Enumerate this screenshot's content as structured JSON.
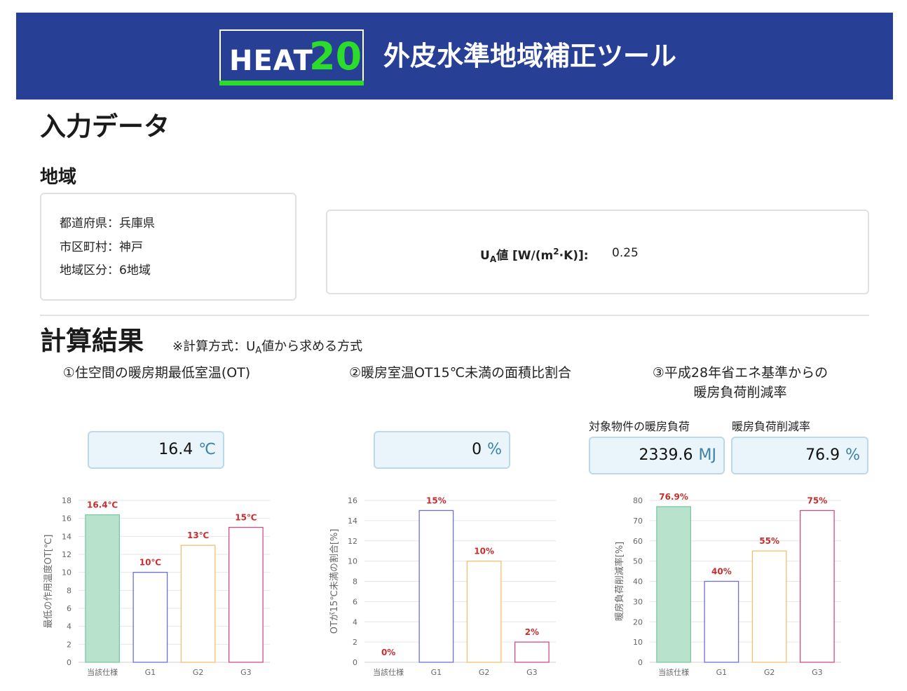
{
  "header": {
    "logo_text": "HEAT",
    "logo_number": "20",
    "title": "外皮水準地域補正ツール"
  },
  "input": {
    "heading": "入力データ",
    "region_heading": "地域",
    "prefecture": "都道府県：兵庫県",
    "city": "市区町村：神戸",
    "zone": "地域区分：6地域",
    "ua_label_prefix": "U",
    "ua_label_sub": "A",
    "ua_label_mid": "値 [W/(m",
    "ua_label_sup": "2",
    "ua_label_suffix": "·K)]:",
    "ua_value": "0.25"
  },
  "results": {
    "heading": "計算結果",
    "method_prefix": "※計算方式：U",
    "method_sub": "A",
    "method_suffix": "値から求める方式",
    "section1": {
      "title": "①住空間の暖房期最低室温(OT)",
      "value": "16.4",
      "unit": "℃"
    },
    "section2": {
      "title": "②暖房室温OT15℃未満の面積比割合",
      "value": "0",
      "unit": "%"
    },
    "section3": {
      "title_line1": "③平成28年省エネ基準からの",
      "title_line2": "暖房負荷削減率",
      "load_label": "対象物件の暖房負荷",
      "load_value": "2339.6",
      "load_unit": "MJ",
      "rate_label": "暖房負荷削減率",
      "rate_value": "76.9",
      "rate_unit": "%"
    }
  },
  "colors": {
    "header_bg": "#283f96",
    "logo_green": "#2bdc2b",
    "bar_fill_current": "#b8e2cc",
    "bar_stroke_current": "#7cc9a2",
    "g1": "#6b6fd8",
    "g2": "#f3c16a",
    "g3": "#d34b86",
    "data_label": "#c62f2f"
  },
  "chart_data": [
    {
      "type": "bar",
      "categories": [
        "当該仕様",
        "G1",
        "G2",
        "G3"
      ],
      "values": [
        16.4,
        10,
        13,
        15
      ],
      "data_labels": [
        "16.4℃",
        "10℃",
        "13℃",
        "15℃"
      ],
      "ylabel": "最低の作用温度OT[℃]",
      "ylim": [
        0,
        18
      ],
      "yticks": [
        0,
        2,
        4,
        6,
        8,
        10,
        12,
        14,
        16,
        18
      ],
      "grid": true
    },
    {
      "type": "bar",
      "categories": [
        "当該仕様",
        "G1",
        "G2",
        "G3"
      ],
      "values": [
        0,
        15,
        10,
        2
      ],
      "data_labels": [
        "0%",
        "15%",
        "10%",
        "2%"
      ],
      "ylabel": "OTが15℃未満の割合[%]",
      "ylim": [
        0,
        16
      ],
      "yticks": [
        0,
        2,
        4,
        6,
        8,
        10,
        12,
        14,
        16
      ],
      "grid": true
    },
    {
      "type": "bar",
      "categories": [
        "当該仕様",
        "G1",
        "G2",
        "G3"
      ],
      "values": [
        76.9,
        40,
        55,
        75
      ],
      "data_labels": [
        "76.9%",
        "40%",
        "55%",
        "75%"
      ],
      "ylabel": "暖房負荷削減率[%]",
      "ylim": [
        0,
        80
      ],
      "yticks": [
        0,
        10,
        20,
        30,
        40,
        50,
        60,
        70,
        80
      ],
      "grid": true
    }
  ]
}
